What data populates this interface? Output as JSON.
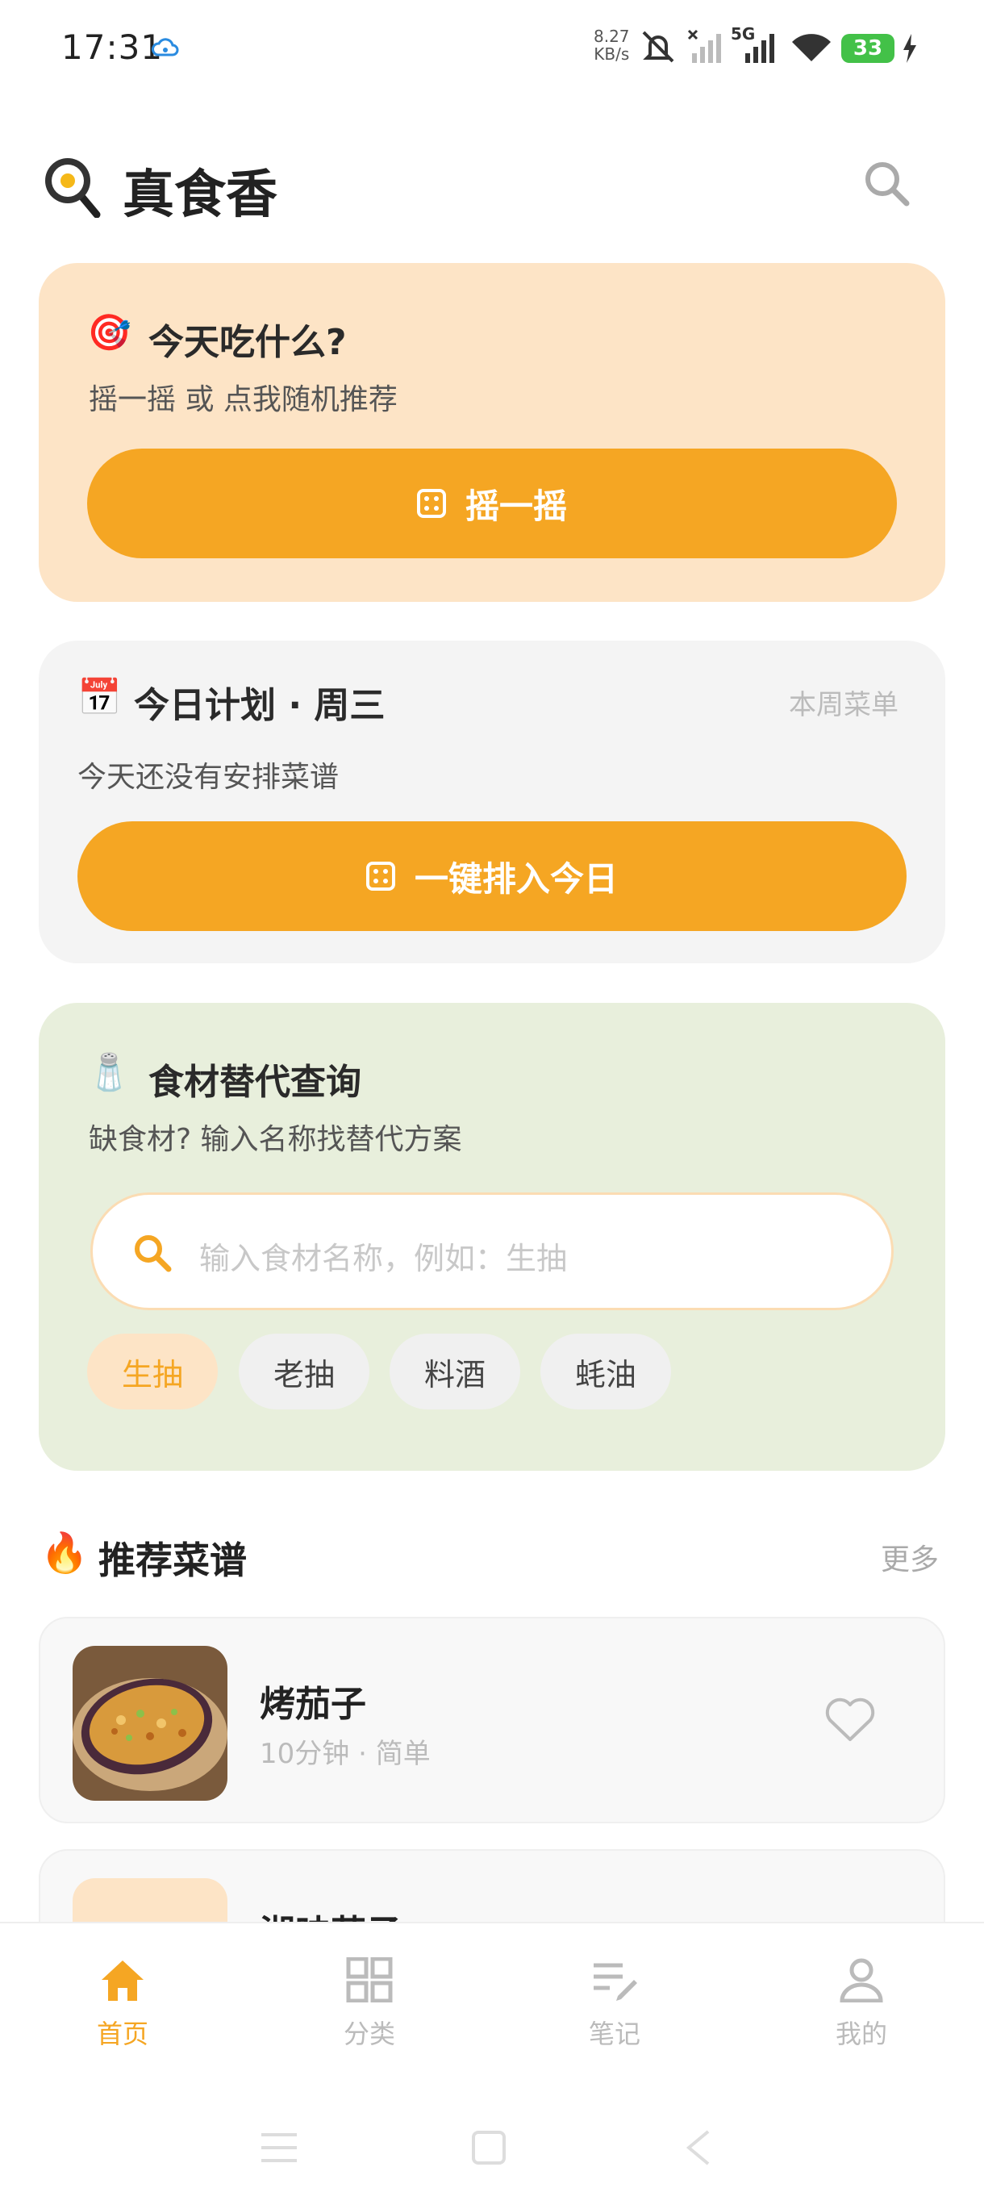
{
  "status_bar": {
    "time": "17:31",
    "net_speed_value": "8.27",
    "net_speed_unit": "KB/s",
    "network": "5G",
    "battery": "33"
  },
  "header": {
    "title": "真食香",
    "logo_icon": "frying-pan-icon",
    "search_icon": "search-icon"
  },
  "shake_card": {
    "emoji": "🎯",
    "title": "今天吃什么?",
    "subtitle": "摇一摇 或 点我随机推荐",
    "button_label": "摇一摇"
  },
  "plan_card": {
    "emoji": "📅",
    "title": "今日计划 · 周三",
    "weekly_link": "本周菜单",
    "subtitle": "今天还没有安排菜谱",
    "button_label": "一键排入今日"
  },
  "substitute_card": {
    "emoji": "🧂",
    "title": "食材替代查询",
    "subtitle": "缺食材? 输入名称找替代方案",
    "search_placeholder": "输入食材名称，例如：生抽",
    "chips": [
      "生抽",
      "老抽",
      "料酒",
      "蚝油"
    ],
    "active_chip": "生抽"
  },
  "recommend": {
    "emoji": "🔥",
    "title": "推荐菜谱",
    "more_label": "更多",
    "recipes": [
      {
        "name": "烤茄子",
        "time": "10分钟",
        "difficulty": "简单"
      },
      {
        "name": "湘味茄子"
      }
    ]
  },
  "tabbar": {
    "items": [
      {
        "label": "首页",
        "icon": "home-icon",
        "active": true
      },
      {
        "label": "分类",
        "icon": "grid-icon",
        "active": false
      },
      {
        "label": "笔记",
        "icon": "note-icon",
        "active": false
      },
      {
        "label": "我的",
        "icon": "user-icon",
        "active": false
      }
    ]
  },
  "colors": {
    "accent": "#f5a623",
    "shake_card_bg": "#fde4c6",
    "plan_card_bg": "#f4f4f4",
    "substitute_card_bg": "#e8efdc",
    "battery": "#43c148"
  }
}
